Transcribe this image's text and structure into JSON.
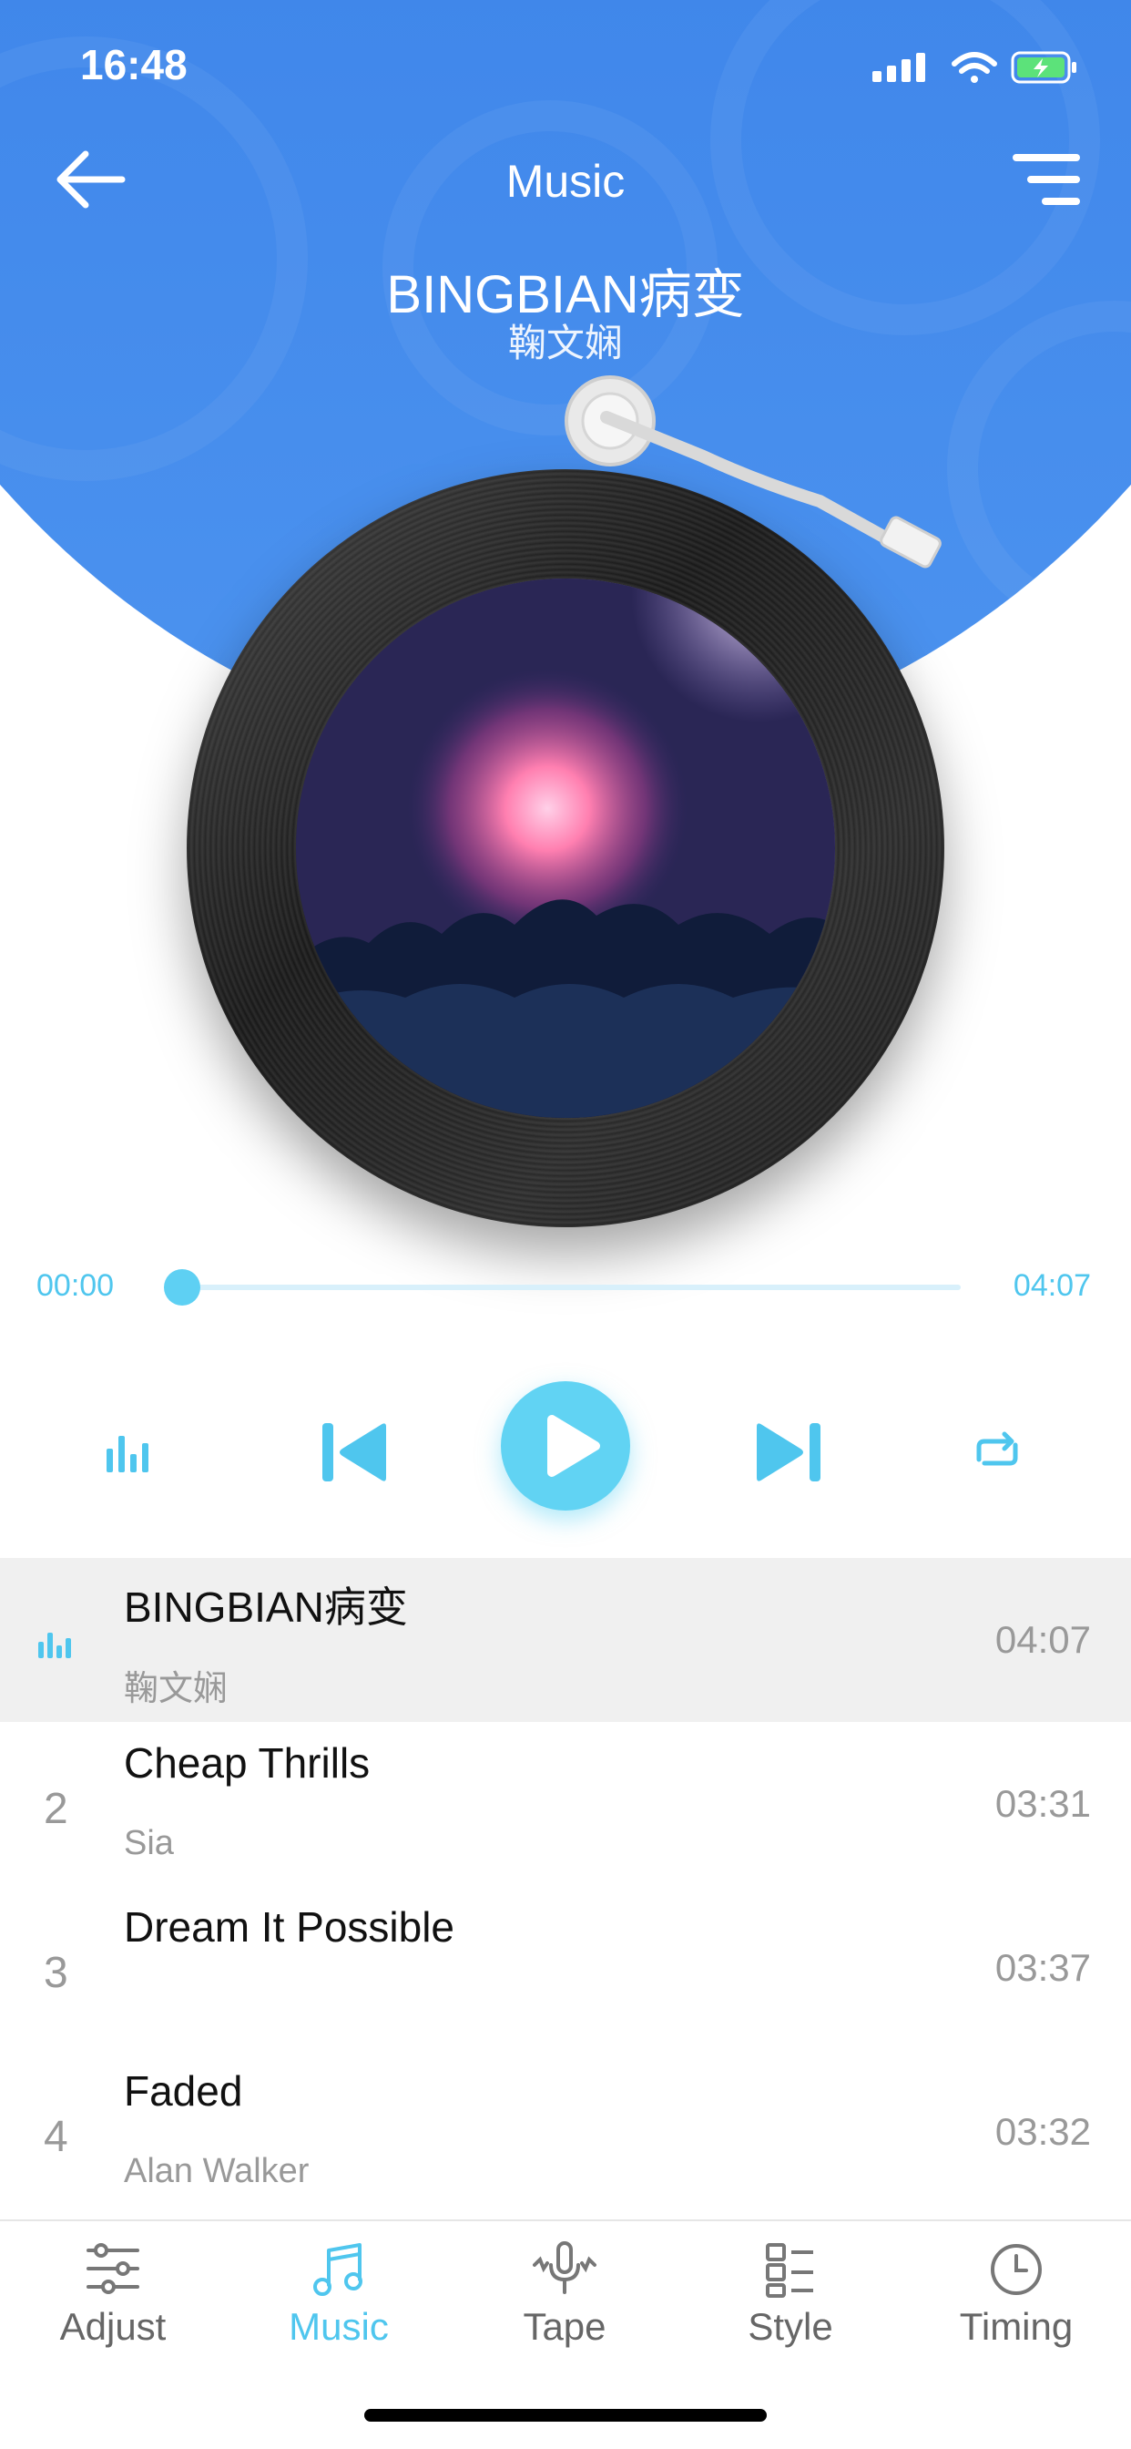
{
  "status_bar": {
    "time": "16:48"
  },
  "header": {
    "title": "Music"
  },
  "now_playing": {
    "title": "BINGBIAN病变",
    "artist": "鞠文娴",
    "current_time": "00:00",
    "total_time": "04:07",
    "progress": 0.0
  },
  "playlist": [
    {
      "index": "",
      "title": "BINGBIAN病变",
      "artist": "鞠文娴",
      "duration": "04:07",
      "playing": true
    },
    {
      "index": "2",
      "title": "Cheap Thrills",
      "artist": "Sia",
      "duration": "03:31",
      "playing": false
    },
    {
      "index": "3",
      "title": "Dream It Possible",
      "artist": "",
      "duration": "03:37",
      "playing": false
    },
    {
      "index": "4",
      "title": "Faded",
      "artist": "Alan Walker",
      "duration": "03:32",
      "playing": false
    }
  ],
  "tabs": [
    {
      "label": "Adjust",
      "icon": "sliders-icon",
      "active": false
    },
    {
      "label": "Music",
      "icon": "music-note-icon",
      "active": true
    },
    {
      "label": "Tape",
      "icon": "microphone-icon",
      "active": false
    },
    {
      "label": "Style",
      "icon": "grid-list-icon",
      "active": false
    },
    {
      "label": "Timing",
      "icon": "clock-icon",
      "active": false
    }
  ],
  "colors": {
    "header_blue": "#3f86ea",
    "accent": "#4fc6ee",
    "play_button": "#61d3f3"
  }
}
